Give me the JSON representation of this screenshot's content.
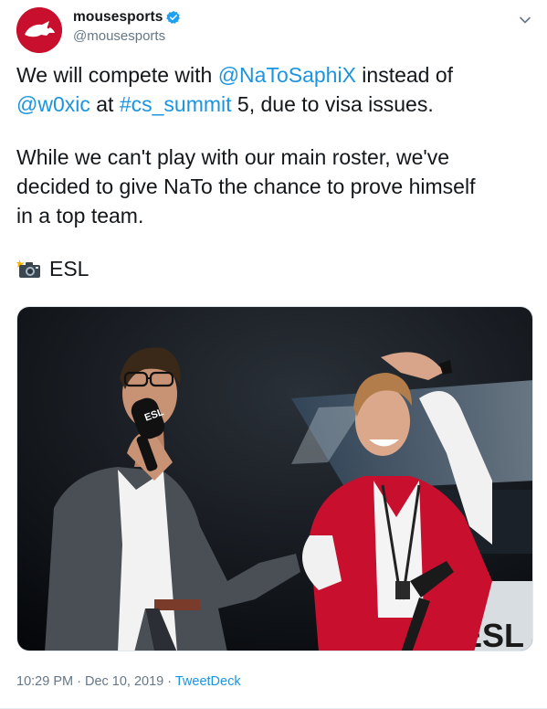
{
  "author": {
    "display_name": "mousesports",
    "handle": "@mousesports"
  },
  "tweet": {
    "line1_pre": "We will compete with ",
    "mention1": "@NaToSaphiX",
    "line1_post": " instead of",
    "mention2": "@w0xic",
    "line2_mid": " at ",
    "hashtag": "#cs_summit",
    "line2_post": " 5, due to visa issues.",
    "para2_l1": "While we can't play with our main roster, we've",
    "para2_l2": "decided to give NaTo the chance to prove himself",
    "para2_l3": "in a top team.",
    "photo_credit": "ESL",
    "mic_flag": "ESL",
    "banner_text": "ESL"
  },
  "meta": {
    "time": "10:29 PM",
    "separator1": " · ",
    "date": "Dec 10, 2019",
    "separator2": " · ",
    "source": "TweetDeck"
  },
  "colors": {
    "link": "#1b95e0",
    "brand": "#c8102e",
    "verified": "#1da1f2",
    "secondary_text": "#657786"
  },
  "icons": {
    "verified": "verified-badge-icon",
    "caret": "chevron-down-icon",
    "camera": "camera-flash-icon",
    "avatar": "mousesports-logo-icon"
  }
}
